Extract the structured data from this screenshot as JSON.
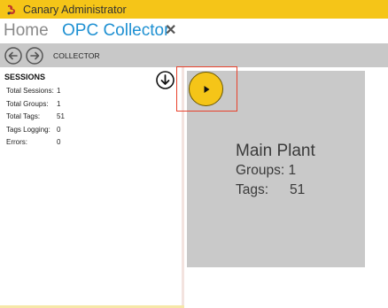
{
  "app": {
    "title": "Canary Administrator"
  },
  "tabs": {
    "home": "Home",
    "active": "OPC Collector",
    "close_glyph": "✕"
  },
  "nav": {
    "section_label": "COLLECTOR",
    "back_icon": "arrow-left-icon",
    "forward_icon": "arrow-right-icon"
  },
  "sessions": {
    "title": "SESSIONS",
    "stats": [
      {
        "label": "Total Sessions:",
        "value": "1"
      },
      {
        "label": "Total Groups:",
        "value": "1"
      },
      {
        "label": "Total Tags:",
        "value": "51"
      },
      {
        "label": "Tags Logging:",
        "value": "0"
      },
      {
        "label": "Errors:",
        "value": "0"
      }
    ]
  },
  "session_card": {
    "name": "Main Plant",
    "groups_label": "Groups: 1",
    "tags_label": "Tags:",
    "tags_value": "51",
    "play_icon": "play-icon"
  },
  "colors": {
    "titlebar": "#f5c518",
    "accent_blue": "#1e90d2",
    "navbar": "#c8c8c8",
    "card": "#c9c9c9",
    "highlight": "#e8412c"
  }
}
